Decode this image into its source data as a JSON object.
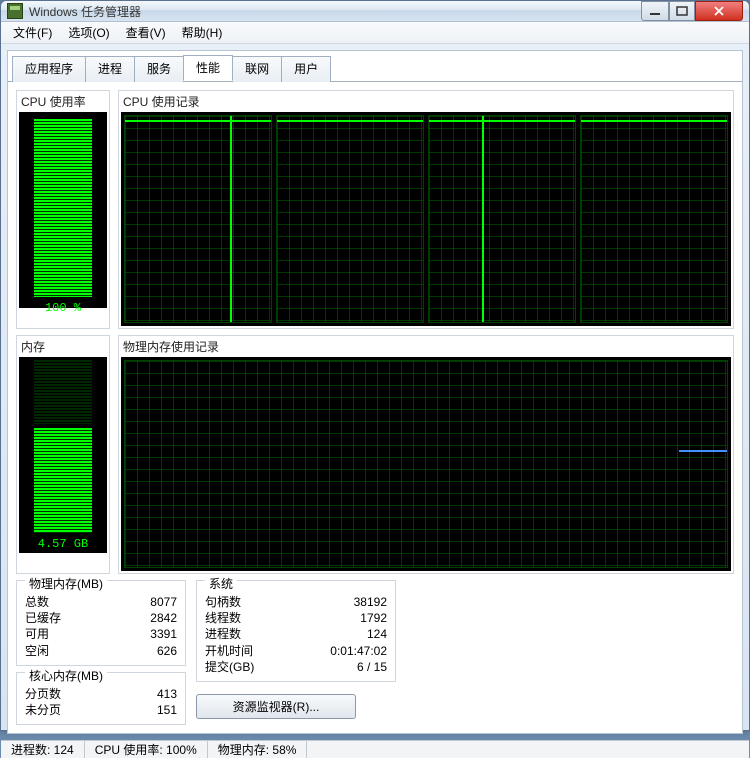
{
  "window": {
    "title": "Windows 任务管理器"
  },
  "menu": {
    "file": "文件(F)",
    "options": "选项(O)",
    "view": "查看(V)",
    "help": "帮助(H)"
  },
  "tabs": {
    "apps": "应用程序",
    "procs": "进程",
    "services": "服务",
    "perf": "性能",
    "net": "联网",
    "users": "用户"
  },
  "labels": {
    "cpu_usage": "CPU 使用率",
    "cpu_history": "CPU 使用记录",
    "memory": "内存",
    "mem_history": "物理内存使用记录",
    "phys_mem": "物理内存(MB)",
    "kernel_mem": "核心内存(MB)",
    "system": "系统",
    "total": "总数",
    "cached": "已缓存",
    "available": "可用",
    "free": "空闲",
    "paged": "分页数",
    "nonpaged": "未分页",
    "handles": "句柄数",
    "threads": "线程数",
    "processes": "进程数",
    "uptime": "开机时间",
    "commit": "提交(GB)",
    "res_monitor": "资源监视器(R)..."
  },
  "values": {
    "cpu_pct": "100 %",
    "mem_gb": "4.57 GB",
    "phys_total": "8077",
    "phys_cached": "2842",
    "phys_avail": "3391",
    "phys_free": "626",
    "kernel_paged": "413",
    "kernel_nonpaged": "151",
    "handles": "38192",
    "threads": "1792",
    "processes": "124",
    "uptime": "0:01:47:02",
    "commit": "6 / 15"
  },
  "status": {
    "procs": "进程数: 124",
    "cpu": "CPU 使用率: 100%",
    "mem": "物理内存: 58%"
  },
  "chart_data": {
    "cpu_meter_pct": 100,
    "mem_meter_pct": 58,
    "cpu_cores": [
      {
        "baseline_pct": 2,
        "spikes_x_pct": [
          72
        ]
      },
      {
        "baseline_pct": 2,
        "spikes_x_pct": []
      },
      {
        "baseline_pct": 2,
        "spikes_x_pct": [
          36
        ]
      },
      {
        "baseline_pct": 2,
        "spikes_x_pct": []
      }
    ],
    "mem_line_pct": 57
  }
}
